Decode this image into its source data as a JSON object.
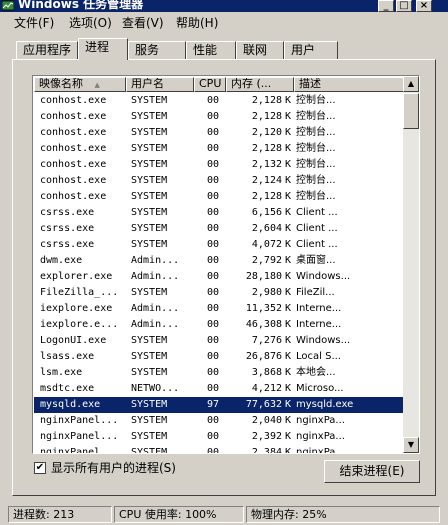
{
  "window": {
    "title": "Windows 任务管理器",
    "minimize_glyph": "_",
    "restore_glyph": "□",
    "close_glyph": "×"
  },
  "menu": [
    {
      "label": "文件(F)"
    },
    {
      "label": "选项(O)"
    },
    {
      "label": "查看(V)"
    },
    {
      "label": "帮助(H)"
    }
  ],
  "tabs": [
    {
      "label": "应用程序",
      "active": false
    },
    {
      "label": "进程",
      "active": true
    },
    {
      "label": "服务",
      "active": false
    },
    {
      "label": "性能",
      "active": false
    },
    {
      "label": "联网",
      "active": false
    },
    {
      "label": "用户",
      "active": false
    }
  ],
  "columns": {
    "name": "映像名称",
    "sort_glyph": "▲",
    "user": "用户名",
    "cpu": "CPU",
    "mem": "内存 (...",
    "desc": "描述"
  },
  "processes": [
    {
      "name": "conhost.exe",
      "user": "SYSTEM",
      "cpu": "00",
      "mem": "2,128",
      "unit": "K",
      "desc": "控制台..."
    },
    {
      "name": "conhost.exe",
      "user": "SYSTEM",
      "cpu": "00",
      "mem": "2,128",
      "unit": "K",
      "desc": "控制台..."
    },
    {
      "name": "conhost.exe",
      "user": "SYSTEM",
      "cpu": "00",
      "mem": "2,120",
      "unit": "K",
      "desc": "控制台..."
    },
    {
      "name": "conhost.exe",
      "user": "SYSTEM",
      "cpu": "00",
      "mem": "2,128",
      "unit": "K",
      "desc": "控制台..."
    },
    {
      "name": "conhost.exe",
      "user": "SYSTEM",
      "cpu": "00",
      "mem": "2,132",
      "unit": "K",
      "desc": "控制台..."
    },
    {
      "name": "conhost.exe",
      "user": "SYSTEM",
      "cpu": "00",
      "mem": "2,124",
      "unit": "K",
      "desc": "控制台..."
    },
    {
      "name": "conhost.exe",
      "user": "SYSTEM",
      "cpu": "00",
      "mem": "2,128",
      "unit": "K",
      "desc": "控制台..."
    },
    {
      "name": "csrss.exe",
      "user": "SYSTEM",
      "cpu": "00",
      "mem": "6,156",
      "unit": "K",
      "desc": "Client ..."
    },
    {
      "name": "csrss.exe",
      "user": "SYSTEM",
      "cpu": "00",
      "mem": "2,604",
      "unit": "K",
      "desc": "Client ..."
    },
    {
      "name": "csrss.exe",
      "user": "SYSTEM",
      "cpu": "00",
      "mem": "4,072",
      "unit": "K",
      "desc": "Client ..."
    },
    {
      "name": "dwm.exe",
      "user": "Admin...",
      "cpu": "00",
      "mem": "2,792",
      "unit": "K",
      "desc": "桌面窗..."
    },
    {
      "name": "explorer.exe",
      "user": "Admin...",
      "cpu": "00",
      "mem": "28,180",
      "unit": "K",
      "desc": "Windows..."
    },
    {
      "name": "FileZilla_...",
      "user": "SYSTEM",
      "cpu": "00",
      "mem": "2,980",
      "unit": "K",
      "desc": "FileZil..."
    },
    {
      "name": "iexplore.exe",
      "user": "Admin...",
      "cpu": "00",
      "mem": "11,352",
      "unit": "K",
      "desc": "Interne..."
    },
    {
      "name": "iexplore.e...",
      "user": "Admin...",
      "cpu": "00",
      "mem": "46,308",
      "unit": "K",
      "desc": "Interne..."
    },
    {
      "name": "LogonUI.exe",
      "user": "SYSTEM",
      "cpu": "00",
      "mem": "7,276",
      "unit": "K",
      "desc": "Windows..."
    },
    {
      "name": "lsass.exe",
      "user": "SYSTEM",
      "cpu": "00",
      "mem": "26,876",
      "unit": "K",
      "desc": "Local S..."
    },
    {
      "name": "lsm.exe",
      "user": "SYSTEM",
      "cpu": "00",
      "mem": "3,868",
      "unit": "K",
      "desc": "本地会..."
    },
    {
      "name": "msdtc.exe",
      "user": "NETWO...",
      "cpu": "00",
      "mem": "4,212",
      "unit": "K",
      "desc": "Microso..."
    },
    {
      "name": "mysqld.exe",
      "user": "SYSTEM",
      "cpu": "97",
      "mem": "77,632",
      "unit": "K",
      "desc": "mysqld.exe",
      "selected": true
    },
    {
      "name": "nginxPanel...",
      "user": "SYSTEM",
      "cpu": "00",
      "mem": "2,040",
      "unit": "K",
      "desc": "nginxPa..."
    },
    {
      "name": "nginxPanel...",
      "user": "SYSTEM",
      "cpu": "00",
      "mem": "2,392",
      "unit": "K",
      "desc": "nginxPa..."
    },
    {
      "name": "nginxPanel...",
      "user": "SYSTEM",
      "cpu": "00",
      "mem": "2,384",
      "unit": "K",
      "desc": "nginxPa..."
    }
  ],
  "scroll": {
    "up_glyph": "▲",
    "down_glyph": "▼"
  },
  "show_all_users": {
    "label": "显示所有用户的进程(S)",
    "checked": true,
    "check_glyph": "✔"
  },
  "end_process": {
    "label": "结束进程(E)"
  },
  "status": {
    "processes": "进程数: 213",
    "cpu": "CPU 使用率: 100%",
    "memory": "物理内存: 25%"
  }
}
